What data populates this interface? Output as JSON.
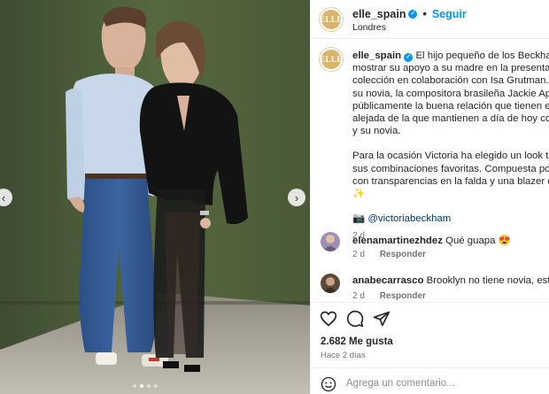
{
  "post": {
    "username": "elle_spain",
    "follow_label": "Seguir",
    "location": "Londres",
    "avatar_logo": "ELLE",
    "caption_lines": [
      "El hijo pequeño de los Beckham, Cruz, ha",
      "mostrar su apoyo a su madre en la presentación de la",
      "colección en colaboración con Isa Grutman. Ha asistido",
      "su novia, la compositora brasileña Jackie Apostel, mo",
      "públicamente la buena relación que tienen entre ellos",
      "alejada de la que mantienen a día de hoy con Brookly",
      "y su novia."
    ],
    "caption_lines_2": [
      "Para la ocasión Victoria ha elegido un look todo al ne",
      "sus combinaciones favoritas. Compuesta por un vestid",
      "con transparencias en la falda y una blazer del mismo"
    ],
    "sparkle": "✨",
    "credit_prefix": "📷",
    "credit_mention": "@victoriabeckham",
    "caption_time": "2 d",
    "likes": "2.682 Me gusta",
    "posted_ago": "Hace 2 días",
    "comment_placeholder": "Agrega un comentario..."
  },
  "comments": [
    {
      "username": "elenamartinezhdez",
      "text": "Qué guapa",
      "emoji": "😍",
      "time": "2 d",
      "reply_label": "Responder"
    },
    {
      "username": "anabecarrasco",
      "text": "Brooklyn no tiene novia, está casado",
      "time": "2 d",
      "reply_label": "Responder"
    }
  ],
  "media": {
    "total_slides": 4,
    "current_slide": 2
  },
  "colors": {
    "accent": "#0095f6",
    "backdrop": "#4b5c3d",
    "floor": "#bdb8ae"
  },
  "icons": [
    "chevron-left-icon",
    "chevron-right-icon",
    "heart-icon",
    "comment-icon",
    "share-icon",
    "emoji-icon",
    "verified-icon"
  ]
}
